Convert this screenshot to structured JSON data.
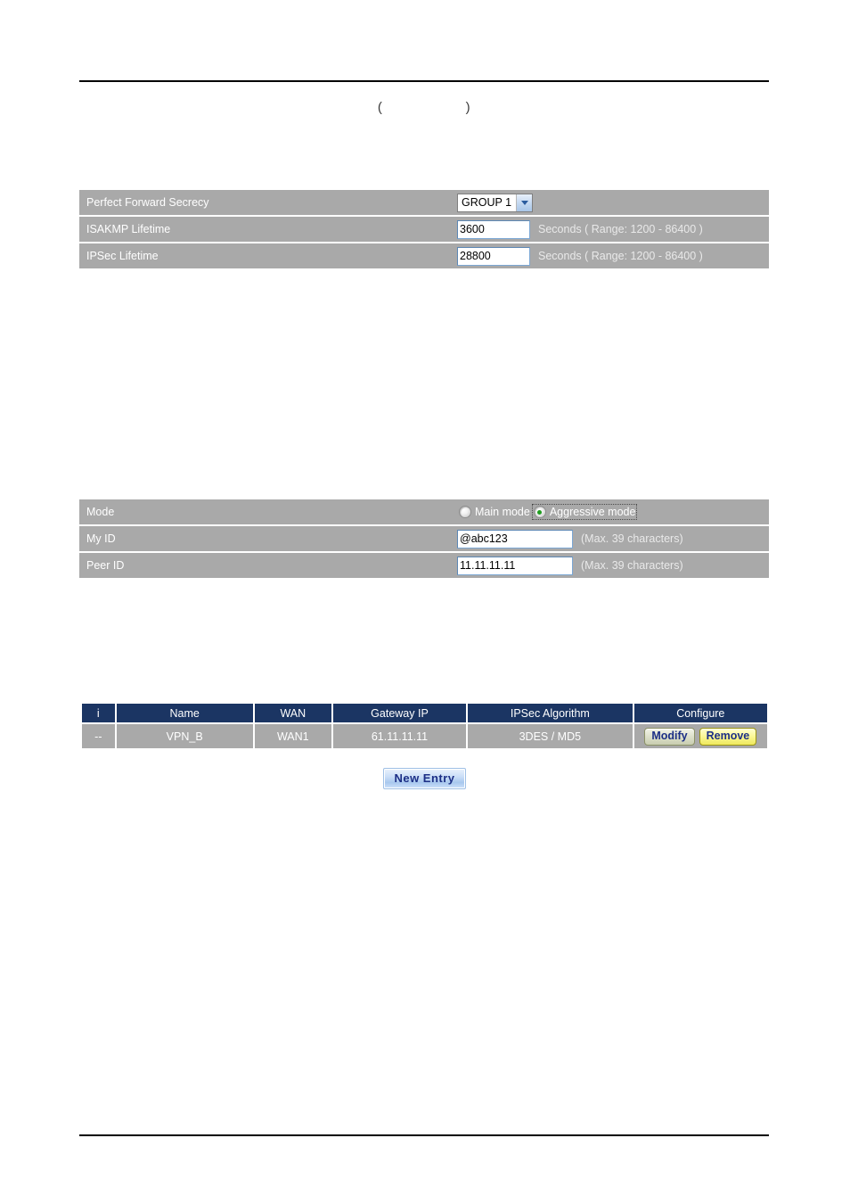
{
  "document": {
    "title_prefix": "(",
    "title_suffix": ")",
    "title": "(                    )"
  },
  "phase1_table": {
    "rows": [
      {
        "label": "Perfect Forward Secrecy",
        "control": "select",
        "value": "GROUP 1",
        "hint": ""
      },
      {
        "label": "ISAKMP Lifetime",
        "control": "text",
        "value": "3600",
        "hint": "Seconds  ( Range: 1200 - 86400 )"
      },
      {
        "label": "IPSec Lifetime",
        "control": "text",
        "value": "28800",
        "hint": "Seconds  ( Range: 1200 - 86400 )"
      }
    ]
  },
  "mode_table": {
    "rows": [
      {
        "label": "Mode",
        "control": "radio",
        "options": [
          {
            "label": "Main mode",
            "checked": false
          },
          {
            "label": "Aggressive mode",
            "checked": true
          }
        ]
      },
      {
        "label": "My ID",
        "control": "text",
        "value": "@abc123",
        "hint": "(Max. 39 characters)"
      },
      {
        "label": "Peer ID",
        "control": "text",
        "value": "11.11.11.11",
        "hint": "(Max. 39 characters)"
      }
    ]
  },
  "vpn_list": {
    "headers": [
      "i",
      "Name",
      "WAN",
      "Gateway IP",
      "IPSec Algorithm",
      "Configure"
    ],
    "rows": [
      {
        "i": "--",
        "name": "VPN_B",
        "wan": "WAN1",
        "gateway_ip": "61.11.11.11",
        "ipsec_algorithm": "3DES / MD5",
        "modify_label": "Modify",
        "remove_label": "Remove"
      }
    ],
    "new_entry_label": "New  Entry"
  },
  "colors": {
    "row_gray": "#a9a9a9",
    "header_navy": "#1b3563",
    "button_navy_text": "#1c2f86",
    "radio_green": "#1f9d1f"
  }
}
